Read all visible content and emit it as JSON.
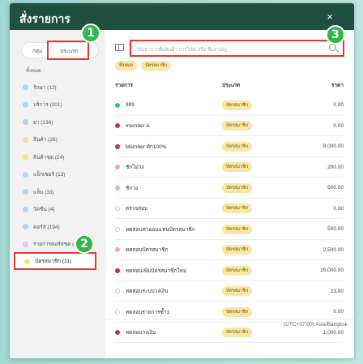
{
  "header": {
    "title": "สั่งรายการ",
    "close": "×"
  },
  "segment": {
    "group": "กลุ่ม",
    "type": "ประเภท"
  },
  "sidebar": {
    "all_label": "ทั้งหมด",
    "items": [
      {
        "label": "รักษา (12)",
        "color": "#a8d8f0"
      },
      {
        "label": "บริการ (201)",
        "color": "#a8d8f0"
      },
      {
        "label": "ยา (136)",
        "color": "#a8d8f0"
      },
      {
        "label": "สินค้า (26)",
        "color": "#f5e08a"
      },
      {
        "label": "สินค้าชุด (24)",
        "color": "#f5e08a"
      },
      {
        "label": "แอ็กเซอร์ (13)",
        "color": "#a8d8f0"
      },
      {
        "label": "แล็บ (33)",
        "color": "#a8d8f0"
      },
      {
        "label": "วัคซีน (4)",
        "color": "#a8d8f0"
      },
      {
        "label": "คอร์ส (194)",
        "color": "#a8d8f0"
      },
      {
        "label": "รายการคอร์สชุด (1",
        "color": "#e0c8e8"
      }
    ],
    "active": {
      "label": "บัตรสมาชิก (31)",
      "color": "#f7e26b"
    }
  },
  "search": {
    "placeholder": "ค้นหาจากชื่อสินค้า บาร์โค้ด หรือ ชื่อสามัญ"
  },
  "chips": [
    "ทั้งหมด",
    "บัตรสมาชิก"
  ],
  "table": {
    "headers": {
      "item": "รายการ",
      "type": "ประเภท",
      "price": "ราคา"
    },
    "rows": [
      {
        "name": "999",
        "type": "บัตรสมาชิก",
        "price": "0.00",
        "dot": "#2ecc71",
        "ring": false
      },
      {
        "name": "member A",
        "type": "บัตรสมาชิก",
        "price": "0.00",
        "dot": "#c0392b",
        "ring": false
      },
      {
        "name": "Member ทัก100%",
        "type": "บัตรสมาชิก",
        "price": "8,000.00",
        "dot": "#c0392b",
        "ring": false
      },
      {
        "name": "ชักไม่วง",
        "type": "บัตรสมาชิก",
        "price": "200.00",
        "dot": "#f4a6c8",
        "ring": false
      },
      {
        "name": "ชักวง",
        "type": "บัตรสมาชิก",
        "price": "500.00",
        "dot": "#f4a6c8",
        "ring": false
      },
      {
        "name": "ตรวจสอบ",
        "type": "บัตรสมาชิก",
        "price": "0.00",
        "dot": "",
        "ring": true
      },
      {
        "name": "ทดสอบค่าออนแทนบัตรสมาชิก",
        "type": "บัตรสมาชิก",
        "price": "500.00",
        "dot": "",
        "ring": true
      },
      {
        "name": "ทดสอบบัตรสมาชิก",
        "type": "บัตรสมาชิก",
        "price": "2,500.00",
        "dot": "#f4a6c8",
        "ring": false
      },
      {
        "name": "ทดสอบเพิ่มบัตรสมาชิกใหม่",
        "type": "บัตรสมาชิก",
        "price": "15,000.00",
        "dot": "#d81b8c",
        "ring": false
      },
      {
        "name": "ทดสอบระบบวงเงิน",
        "type": "บัตรสมาชิก",
        "price": "23.00",
        "dot": "",
        "ring": true
      },
      {
        "name": "ทดสอบรายการซ้ำ1",
        "type": "บัตรสมาชิก",
        "price": "0.00",
        "dot": "",
        "ring": true
      },
      {
        "name": "ทดสอบวงเงิน",
        "type": "บัตรสมาชิก",
        "price": "1,000.00",
        "dot": "#c0392b",
        "ring": false
      }
    ]
  },
  "footer": {
    "timezone": "(UTC+07:00) Asia/Bangkok"
  },
  "callouts": [
    "1",
    "2",
    "3"
  ]
}
